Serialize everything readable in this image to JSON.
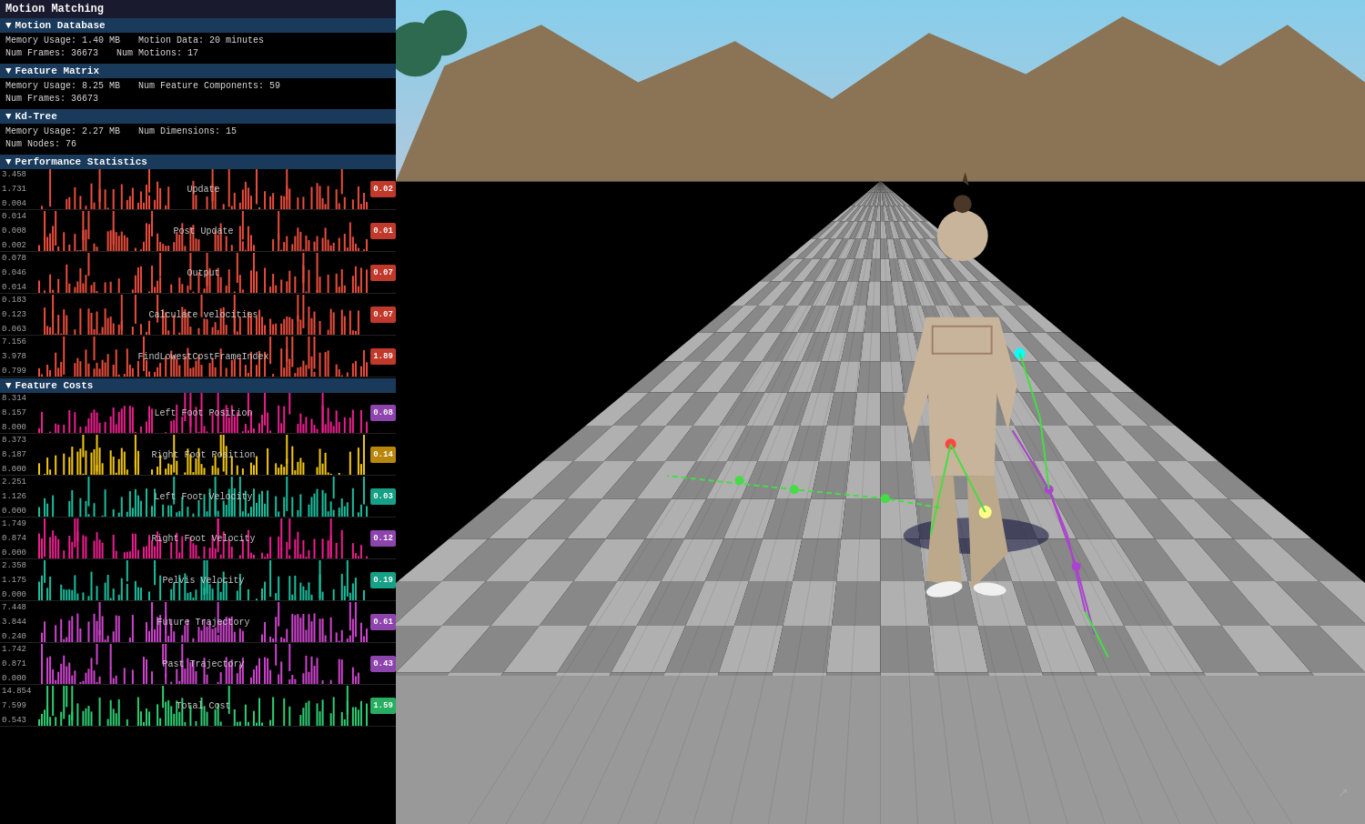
{
  "app": {
    "title": "Motion Matching"
  },
  "motion_database": {
    "label": "Motion Database",
    "memory_usage": "Memory Usage: 1.40 MB",
    "motion_data": "Motion Data: 20 minutes",
    "num_frames": "Num Frames: 36673",
    "num_motions": "Num Motions: 17"
  },
  "feature_matrix": {
    "label": "Feature Matrix",
    "memory_usage": "Memory Usage: 8.25 MB",
    "num_feature_components": "Num Feature Components: 59",
    "num_frames": "Num Frames: 36673"
  },
  "kd_tree": {
    "label": "Kd-Tree",
    "memory_usage": "Memory Usage: 2.27 MB",
    "num_nodes": "Num Nodes: 76",
    "num_dimensions": "Num Dimensions: 15"
  },
  "performance_statistics": {
    "label": "Performance Statistics",
    "charts": [
      {
        "id": "update",
        "title": "Update",
        "val_top": "3.458",
        "val_mid": "1.731",
        "val_bot": "0.004",
        "badge": "0.02",
        "badge_class": "badge-red",
        "bar_color": "#e74c3c"
      },
      {
        "id": "post-update",
        "title": "Post Update",
        "val_top": "0.014",
        "val_mid": "0.008",
        "val_bot": "0.002",
        "badge": "0.01",
        "badge_class": "badge-red",
        "bar_color": "#e74c3c"
      },
      {
        "id": "output",
        "title": "Output",
        "val_top": "0.078",
        "val_mid": "0.046",
        "val_bot": "0.014",
        "badge": "0.07",
        "badge_class": "badge-red",
        "bar_color": "#e74c3c"
      },
      {
        "id": "calculate-velocities",
        "title": "Calculate velocities",
        "val_top": "0.183",
        "val_mid": "0.123",
        "val_bot": "0.063",
        "badge": "0.07",
        "badge_class": "badge-red",
        "bar_color": "#e74c3c"
      },
      {
        "id": "find-lowest",
        "title": "FindLowestCostFrameIndex",
        "val_top": "7.156",
        "val_mid": "3.978",
        "val_bot": "0.799",
        "badge": "1.89",
        "badge_class": "badge-red",
        "bar_color": "#e74c3c"
      }
    ]
  },
  "feature_costs": {
    "label": "Feature Costs",
    "charts": [
      {
        "id": "left-foot-pos",
        "title": "Left Foot Position",
        "val_top": "8.314",
        "val_mid": "8.157",
        "val_bot": "8.000",
        "badge": "0.08",
        "badge_class": "badge-pink",
        "bar_color": "#e91e8c"
      },
      {
        "id": "right-foot-pos",
        "title": "Right Foot Position",
        "val_top": "8.373",
        "val_mid": "8.187",
        "val_bot": "8.000",
        "badge": "0.14",
        "badge_class": "badge-yellow",
        "bar_color": "#f1c40f"
      },
      {
        "id": "left-foot-vel",
        "title": "Left Foot Velocity",
        "val_top": "2.251",
        "val_mid": "1.126",
        "val_bot": "0.000",
        "badge": "0.03",
        "badge_class": "badge-teal",
        "bar_color": "#1abc9c"
      },
      {
        "id": "right-foot-vel",
        "title": "Right Foot Velocity",
        "val_top": "1.749",
        "val_mid": "0.874",
        "val_bot": "0.000",
        "badge": "0.12",
        "badge_class": "badge-pink",
        "bar_color": "#e91e8c"
      },
      {
        "id": "pelvis-vel",
        "title": "Pelvis Velocity",
        "val_top": "2.358",
        "val_mid": "1.175",
        "val_bot": "0.000",
        "badge": "0.19",
        "badge_class": "badge-teal",
        "bar_color": "#1abc9c"
      },
      {
        "id": "future-trajectory",
        "title": "Future Trajectory",
        "val_top": "7.448",
        "val_mid": "3.844",
        "val_bot": "0.240",
        "badge": "0.61",
        "badge_class": "badge-pink",
        "bar_color": "#cc44cc"
      },
      {
        "id": "past-trajectory",
        "title": "Past Trajectory",
        "val_top": "1.742",
        "val_mid": "0.871",
        "val_bot": "0.000",
        "badge": "0.43",
        "badge_class": "badge-pink",
        "bar_color": "#cc44cc"
      },
      {
        "id": "total-cost",
        "title": "Total Cost",
        "val_top": "14.854",
        "val_mid": "7.599",
        "val_bot": "0.543",
        "badge": "1.59",
        "badge_class": "badge-green",
        "bar_color": "#2ecc71"
      }
    ]
  }
}
